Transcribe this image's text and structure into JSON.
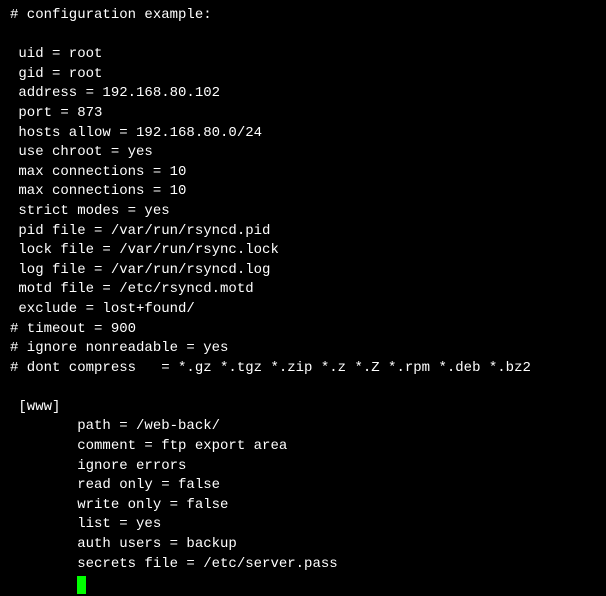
{
  "lines": {
    "l0": "# configuration example:",
    "l1": "",
    "l2": " uid = root",
    "l3": " gid = root",
    "l4": " address = 192.168.80.102",
    "l5": " port = 873",
    "l6": " hosts allow = 192.168.80.0/24",
    "l7": " use chroot = yes",
    "l8": " max connections = 10",
    "l9": " max connections = 10",
    "l10": " strict modes = yes",
    "l11": " pid file = /var/run/rsyncd.pid",
    "l12": " lock file = /var/run/rsync.lock",
    "l13": " log file = /var/run/rsyncd.log",
    "l14": " motd file = /etc/rsyncd.motd",
    "l15": " exclude = lost+found/",
    "l16": "# timeout = 900",
    "l17": "# ignore nonreadable = yes",
    "l18": "# dont compress   = *.gz *.tgz *.zip *.z *.Z *.rpm *.deb *.bz2",
    "l19": "",
    "l20": " [www]",
    "l21": "        path = /web-back/",
    "l22": "        comment = ftp export area",
    "l23": "        ignore errors",
    "l24": "        read only = false",
    "l25": "        write only = false",
    "l26": "        list = yes",
    "l27": "        auth users = backup",
    "l28": "        secrets file = /etc/server.pass"
  }
}
